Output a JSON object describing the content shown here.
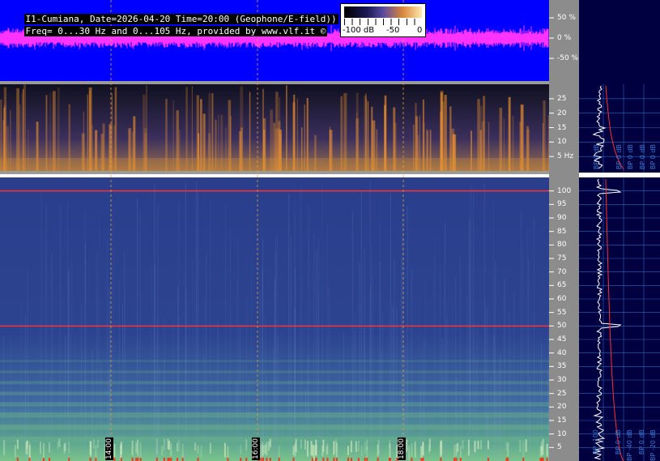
{
  "header": {
    "line1": "I1-Cumiana, Date=2026-04-20 Time=20:00 (Geophone/E-field))",
    "line2": "Freq= 0...30 Hz and 0...105 Hz, provided by www.vlf.it ©"
  },
  "colorbar": {
    "labels": [
      "-100 dB",
      "-50",
      "0"
    ]
  },
  "colors": {
    "waveform_bg": "#0000ff",
    "waveform": "#ff33ff",
    "spectrogram_low_bg": "#1c1c3a",
    "spectrogram_low_hot": "#ff9a2a",
    "spectrogram_high_bg": "#2c3f8e",
    "spectrogram_high_warm": "#6ab08c",
    "axis_panel": "#8c8c8c",
    "side_panel": "#000040",
    "grid": "#3a7fd6",
    "hum_line": "#ff3030",
    "profile_line": "#ffffff",
    "profile_trend": "#ff3030"
  },
  "chart_data": [
    {
      "type": "line",
      "name": "waveform",
      "ylabel_ticks": [
        "50 %",
        "0 %",
        "-50 %"
      ],
      "y_ticks": [
        50,
        0,
        -50
      ],
      "ylim": [
        -100,
        100
      ],
      "note_values": "amplitude roughly within ±30 %"
    },
    {
      "type": "heatmap",
      "name": "spectrogram-low",
      "ylim": [
        0,
        30
      ],
      "y_ticks": [
        5,
        10,
        15,
        20,
        25
      ],
      "y_tick_labels": [
        "5 Hz",
        "10",
        "15",
        "20",
        "25"
      ]
    },
    {
      "type": "heatmap",
      "name": "spectrogram-high",
      "ylim": [
        0,
        105
      ],
      "y_ticks": [
        5,
        10,
        15,
        20,
        25,
        30,
        35,
        40,
        45,
        50,
        55,
        60,
        65,
        70,
        75,
        80,
        85,
        90,
        95,
        100
      ],
      "y_tick_labels": [
        "5",
        "10",
        "15",
        "20",
        "25",
        "30",
        "35",
        "40",
        "45",
        "50",
        "55",
        "60",
        "65",
        "70",
        "75",
        "80",
        "85",
        "90",
        "95",
        "100"
      ],
      "time_markers": [
        "14:00",
        "16:00",
        "18:00"
      ],
      "hum_lines_hz": [
        50,
        100
      ]
    },
    {
      "type": "line",
      "name": "side-profile-low",
      "x_labels": [
        "BP 0 dB",
        "BP 0 dB",
        "BP 0 dB",
        "BP 0 dB",
        "BP 0 dB"
      ]
    },
    {
      "type": "line",
      "name": "side-profile-high",
      "x_labels": [
        "BP -100",
        "BP 0 dB",
        "BP -40 dB",
        "BP 0 dB",
        "BP -20 dB"
      ]
    }
  ]
}
